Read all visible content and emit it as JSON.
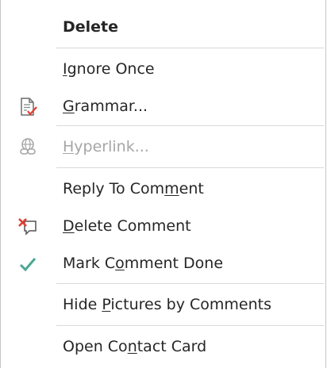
{
  "menu": {
    "items": [
      {
        "id": "delete",
        "pre": "",
        "ul": "",
        "post": "Delete"
      },
      {
        "id": "ignore-once",
        "pre": "",
        "ul": "I",
        "post": "gnore Once"
      },
      {
        "id": "grammar",
        "pre": "",
        "ul": "G",
        "post": "rammar..."
      },
      {
        "id": "hyperlink",
        "pre": "",
        "ul": "H",
        "post": "yperlink..."
      },
      {
        "id": "reply-comment",
        "pre": "Reply To Com",
        "ul": "m",
        "post": "ent"
      },
      {
        "id": "delete-comment",
        "pre": "",
        "ul": "D",
        "post": "elete Comment"
      },
      {
        "id": "mark-done",
        "pre": "Mark C",
        "ul": "o",
        "post": "mment Done"
      },
      {
        "id": "hide-pictures",
        "pre": "Hide ",
        "ul": "P",
        "post": "ictures by Comments"
      },
      {
        "id": "contact-card",
        "pre": "Open Co",
        "ul": "n",
        "post": "tact Card"
      }
    ]
  },
  "icons": {
    "grammar": "grammar-check-icon",
    "hyperlink": "hyperlink-globe-icon",
    "delete_comment": "delete-comment-icon",
    "mark_done": "checkmark-icon"
  },
  "colors": {
    "text": "#262626",
    "disabled": "#a6a6a6",
    "separator": "#d9d9d9",
    "border": "#c6c6c6",
    "check": "#4aa894",
    "delete_x": "#e03c31"
  }
}
